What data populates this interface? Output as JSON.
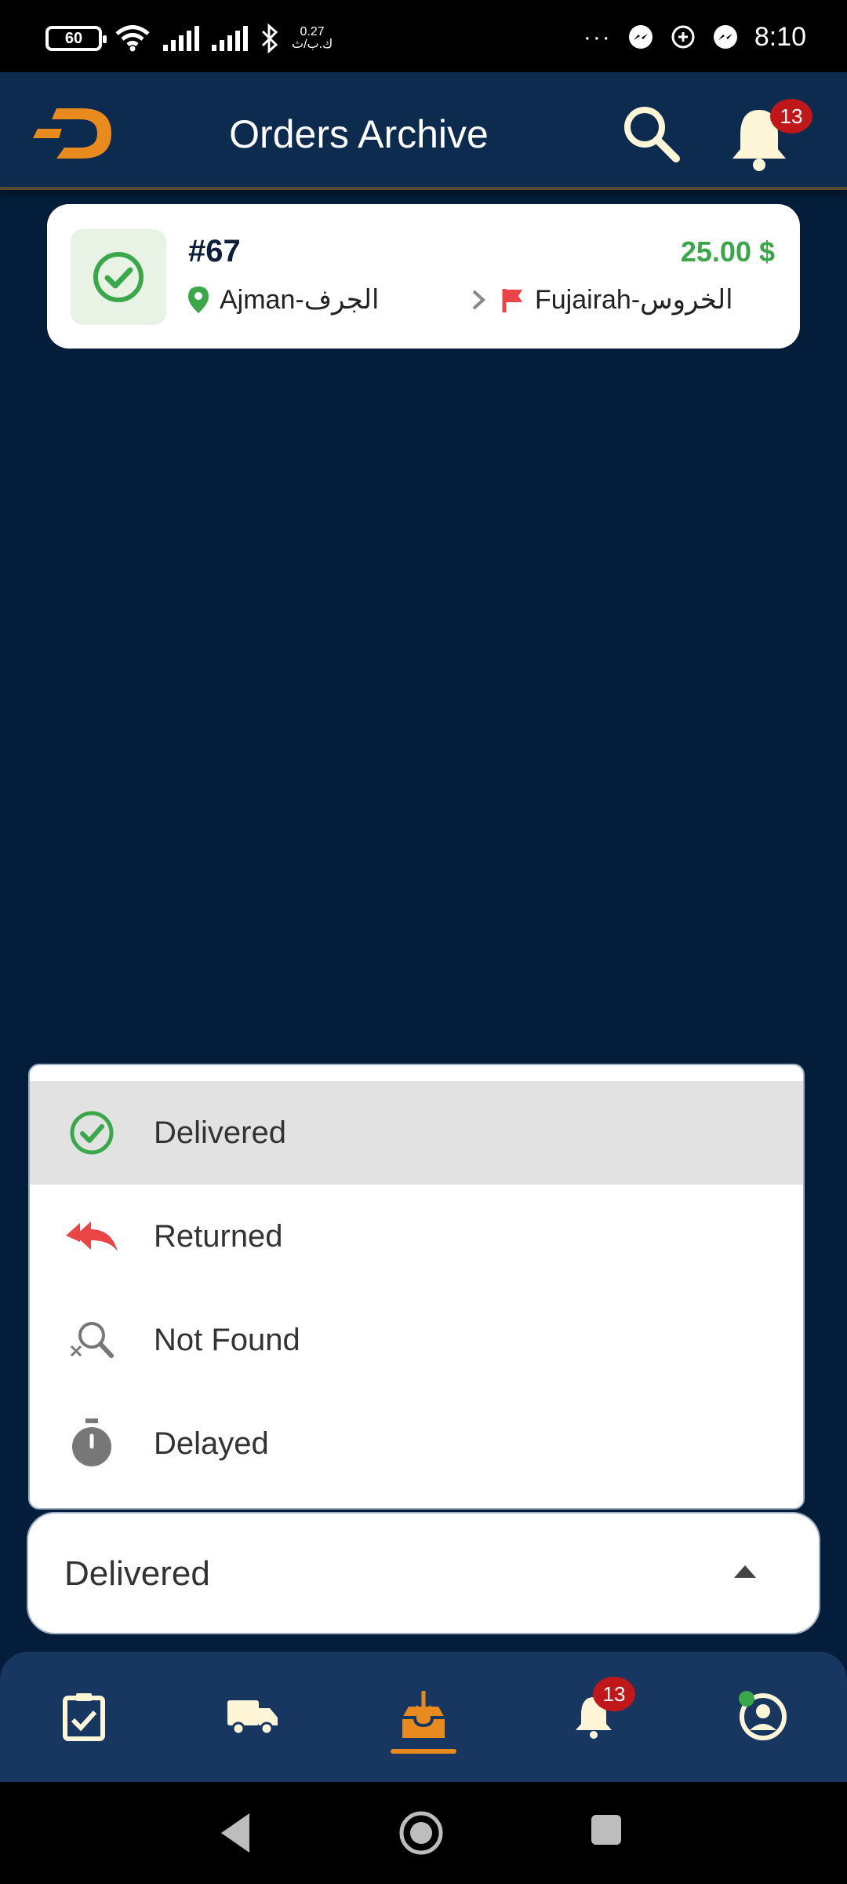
{
  "status_bar": {
    "battery": "60",
    "net_speed_value": "0.27",
    "net_speed_unit": "ك.ب/ث",
    "overflow": "···",
    "time": "8:10"
  },
  "app_bar": {
    "title": "Orders Archive",
    "notification_count": "13"
  },
  "order": {
    "id": "#67",
    "price": "25.00 $",
    "from": "Ajman-الجرف",
    "to": "Fujairah-الخروس",
    "status_icon": "check-circle-icon"
  },
  "status_menu": {
    "items": [
      {
        "label": "Delivered",
        "icon": "check-circle-icon",
        "color": "#3aa84a",
        "selected": true
      },
      {
        "label": "Returned",
        "icon": "reply-all-icon",
        "color": "#e94545",
        "selected": false
      },
      {
        "label": "Not Found",
        "icon": "search-off-icon",
        "color": "#777777",
        "selected": false
      },
      {
        "label": "Delayed",
        "icon": "timer-icon",
        "color": "#777777",
        "selected": false
      }
    ]
  },
  "select": {
    "value": "Delivered"
  },
  "bottom_nav": {
    "notification_count": "13",
    "active": "archive"
  },
  "colors": {
    "background": "#031d3a",
    "accent": "#e98a1e",
    "success": "#3aa84a",
    "danger": "#e94545",
    "badge": "#c0171b"
  }
}
